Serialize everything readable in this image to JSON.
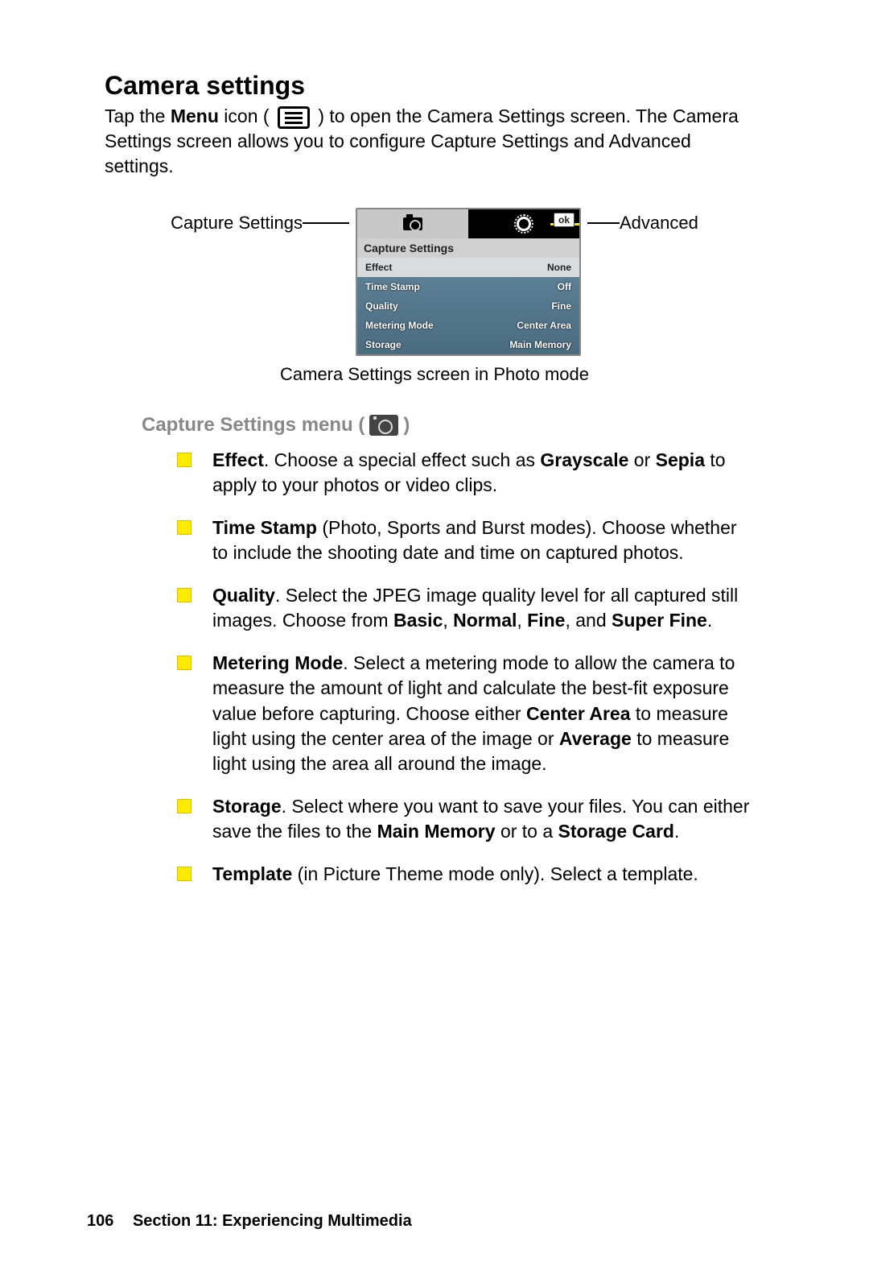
{
  "heading": "Camera settings",
  "intro": {
    "pre": "Tap the ",
    "bold1": "Menu",
    "mid1": " icon ( ",
    "mid2": " ) to open the Camera Settings screen. The Camera Settings screen allows you to configure Capture Settings and Advanced settings."
  },
  "callouts": {
    "left": "Capture Settings",
    "right": "Advanced"
  },
  "screenshot": {
    "ok": "ok",
    "title": "Capture Settings",
    "rows": [
      {
        "label": "Effect",
        "value": "None",
        "selected": true
      },
      {
        "label": "Time Stamp",
        "value": "Off",
        "selected": false
      },
      {
        "label": "Quality",
        "value": "Fine",
        "selected": false
      },
      {
        "label": "Metering Mode",
        "value": "Center Area",
        "selected": false
      },
      {
        "label": "Storage",
        "value": "Main Memory",
        "selected": false
      }
    ]
  },
  "figure_caption": "Camera Settings screen in Photo mode",
  "subheading": {
    "pre": "Capture Settings menu ( ",
    "post": " )"
  },
  "bullets": [
    {
      "parts": [
        {
          "b": true,
          "t": "Effect"
        },
        {
          "t": ". Choose a special effect such as "
        },
        {
          "b": true,
          "t": "Grayscale"
        },
        {
          "t": " or "
        },
        {
          "b": true,
          "t": "Sepia"
        },
        {
          "t": " to apply to your photos or video clips."
        }
      ]
    },
    {
      "parts": [
        {
          "b": true,
          "t": "Time Stamp"
        },
        {
          "t": " (Photo, Sports and Burst modes). Choose whether to include the shooting date and time on captured photos."
        }
      ]
    },
    {
      "parts": [
        {
          "b": true,
          "t": "Quality"
        },
        {
          "t": ". Select the JPEG image quality level for all captured still images. Choose from "
        },
        {
          "b": true,
          "t": "Basic"
        },
        {
          "t": ", "
        },
        {
          "b": true,
          "t": "Normal"
        },
        {
          "t": ", "
        },
        {
          "b": true,
          "t": "Fine"
        },
        {
          "t": ", and "
        },
        {
          "b": true,
          "t": "Super Fine"
        },
        {
          "t": "."
        }
      ]
    },
    {
      "parts": [
        {
          "b": true,
          "t": "Metering Mode"
        },
        {
          "t": ". Select a metering mode to allow the camera to measure the amount of light and calculate the best-fit exposure value before capturing. Choose either "
        },
        {
          "b": true,
          "t": "Center Area"
        },
        {
          "t": " to measure light using the center area of the image or "
        },
        {
          "b": true,
          "t": "Average"
        },
        {
          "t": " to measure light using the area all around the image."
        }
      ]
    },
    {
      "parts": [
        {
          "b": true,
          "t": "Storage"
        },
        {
          "t": ". Select where you want to save your files. You can either save the files to the "
        },
        {
          "b": true,
          "t": "Main Memory"
        },
        {
          "t": " or to a "
        },
        {
          "b": true,
          "t": "Storage Card"
        },
        {
          "t": "."
        }
      ]
    },
    {
      "parts": [
        {
          "b": true,
          "t": "Template"
        },
        {
          "t": " (in Picture Theme mode only). Select a template."
        }
      ]
    }
  ],
  "footer": {
    "page": "106",
    "section": "Section 11: Experiencing Multimedia"
  }
}
